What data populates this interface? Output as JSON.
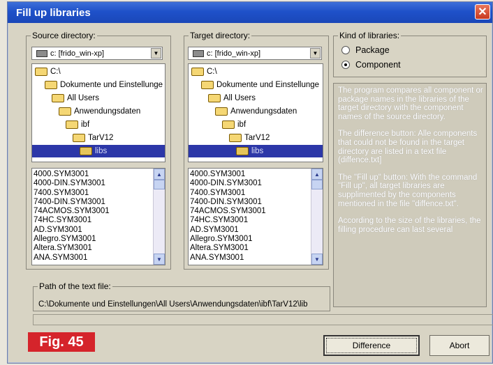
{
  "window": {
    "title": "Fill up libraries",
    "close_label": "✕"
  },
  "source": {
    "legend": "Source directory:",
    "drive": "c: [frido_win-xp]",
    "tree": [
      "C:\\",
      "Dokumente und Einstellunge",
      "All Users",
      "Anwendungsdaten",
      "ibf",
      "TarV12",
      "libs"
    ],
    "files": [
      "4000.SYM3001",
      "4000-DIN.SYM3001",
      "7400.SYM3001",
      "7400-DIN.SYM3001",
      "74ACMOS.SYM3001",
      "74HC.SYM3001",
      "AD.SYM3001",
      "Allegro.SYM3001",
      "Altera.SYM3001",
      "ANA.SYM3001"
    ]
  },
  "target": {
    "legend": "Target directory:",
    "drive": "c: [frido_win-xp]",
    "tree": [
      "C:\\",
      "Dokumente und Einstellunge",
      "All Users",
      "Anwendungsdaten",
      "ibf",
      "TarV12",
      "libs"
    ],
    "files": [
      "4000.SYM3001",
      "4000-DIN.SYM3001",
      "7400.SYM3001",
      "7400-DIN.SYM3001",
      "74ACMOS.SYM3001",
      "74HC.SYM3001",
      "AD.SYM3001",
      "Allegro.SYM3001",
      "Altera.SYM3001",
      "ANA.SYM3001"
    ]
  },
  "kind": {
    "legend": "Kind of libraries:",
    "options": [
      "Package",
      "Component"
    ],
    "selected": "Component"
  },
  "info": {
    "paragraphs": [
      "The program compares all component or package names in the libraries of the target directory with the component names of the source directory.",
      "The difference button: Alle components that could not be found in the target directory are listed  in a text file (diffence.txt]",
      "The \"Fill up\" button: With the command \"Fill up\", all target libraries are supplimented by the components mentioned in the file \"diffence.txt\".",
      "According to the size of the libraries, the filling procedure can last several"
    ]
  },
  "path": {
    "legend": "Path of the text file:",
    "value": "C:\\Dokumente und Einstellungen\\All Users\\Anwendungsdaten\\ibf\\TarV12\\lib"
  },
  "buttons": {
    "difference": "Difference",
    "abort": "Abort"
  },
  "figure_label": "Fig. 45"
}
